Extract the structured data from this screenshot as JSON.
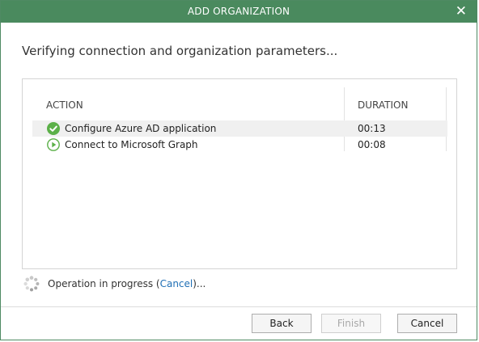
{
  "window": {
    "title": "ADD ORGANIZATION",
    "close_glyph": "✕",
    "accent_color": "#4a8a5e"
  },
  "heading": "Verifying connection and organization parameters...",
  "table": {
    "columns": {
      "action": "ACTION",
      "duration": "DURATION"
    },
    "rows": [
      {
        "action": "Configure Azure AD application",
        "duration": "00:13",
        "status_icon": "success-check-icon"
      },
      {
        "action": "Connect to Microsoft Graph",
        "duration": "00:08",
        "status_icon": "running-play-icon"
      }
    ]
  },
  "status": {
    "prefix": "Operation in progress (",
    "cancel_link": "Cancel",
    "suffix": ")...",
    "icon": "spinner-icon"
  },
  "buttons": {
    "back": "Back",
    "finish": "Finish",
    "cancel": "Cancel"
  }
}
